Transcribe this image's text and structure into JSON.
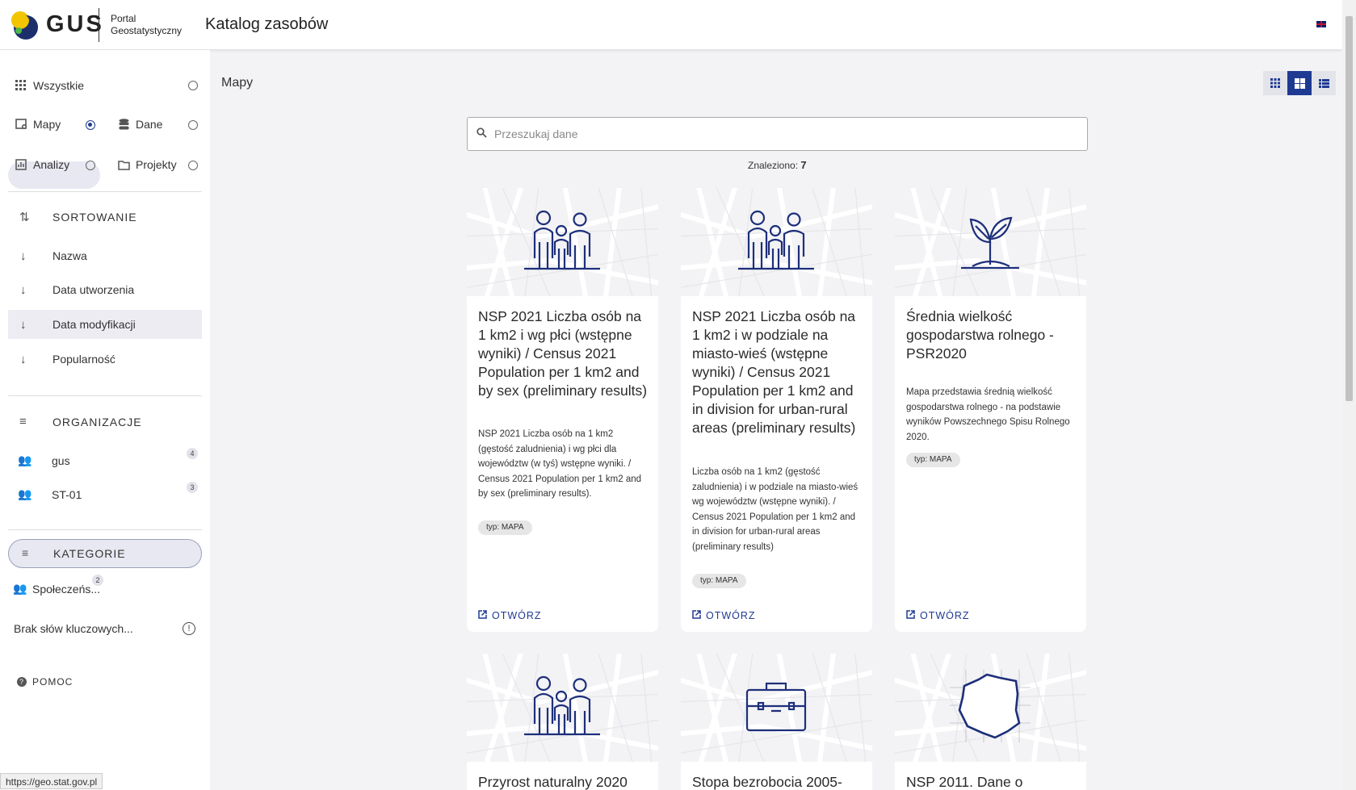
{
  "header": {
    "logo_text": "GUS",
    "portal_line1": "Portal",
    "portal_line2": "Geostatystyczny",
    "app_title": "Katalog zasobów"
  },
  "sidebar": {
    "types": {
      "all": "Wszystkie",
      "maps": "Mapy",
      "data": "Dane",
      "analyses": "Analizy",
      "projects": "Projekty"
    },
    "sorting": {
      "title": "SORTOWANIE",
      "items": [
        "Nazwa",
        "Data utworzenia",
        "Data modyfikacji",
        "Popularność"
      ]
    },
    "organizations": {
      "title": "ORGANIZACJE",
      "items": [
        {
          "name": "gus",
          "count": "4"
        },
        {
          "name": "ST-01",
          "count": "3"
        }
      ]
    },
    "categories": {
      "title": "KATEGORIE",
      "item": "Społeczeńs...",
      "count": "2"
    },
    "keywords": "Brak słów kluczowych...",
    "help": "POMOC"
  },
  "main": {
    "title": "Mapy",
    "search_placeholder": "Przeszukaj dane",
    "found_label": "Znaleziono:",
    "found_count": "7",
    "open_label": "OTWÓRZ",
    "cards": [
      {
        "title": "NSP 2021 Liczba osób na 1 km2 i wg płci (wstępne wyniki) / Census 2021 Population per 1 km2 and by sex (preliminary results)",
        "desc": "NSP 2021 Liczba osób na 1 km2 (gęstość zaludnienia) i wg płci dla województw (w tyś) wstępne wyniki. / Census 2021 Population per 1 km2 and by sex (preliminary results).",
        "tag": "typ: MAPA",
        "icon": "family-icon"
      },
      {
        "title": "NSP 2021 Liczba osób na 1 km2 i w podziale na miasto-wieś (wstępne wyniki) / Census 2021 Population per 1 km2 and in division for urban-rural areas (preliminary results)",
        "desc": "Liczba osób na 1 km2 (gęstość zaludnienia) i w podziale na miasto-wieś wg województw (wstępne wyniki). / Census 2021 Population per 1 km2 and in division for urban-rural areas (preliminary results)",
        "tag": "typ: MAPA",
        "icon": "family-icon"
      },
      {
        "title": "Średnia wielkość gospodarstwa rolnego - PSR2020",
        "desc": "Mapa przedstawia średnią wielkość gospodarstwa rolnego - na podstawie wyników Powszechnego Spisu Rolnego 2020.",
        "tag": "typ: MAPA",
        "icon": "plant-icon"
      },
      {
        "title": "Przyrost naturalny 2020",
        "icon": "family-icon"
      },
      {
        "title": "Stopa bezrobocia 2005-",
        "icon": "briefcase-icon"
      },
      {
        "title": "NSP 2011. Dane o",
        "icon": "poland-map-icon"
      }
    ]
  },
  "statusbar": "https://geo.stat.gov.pl"
}
